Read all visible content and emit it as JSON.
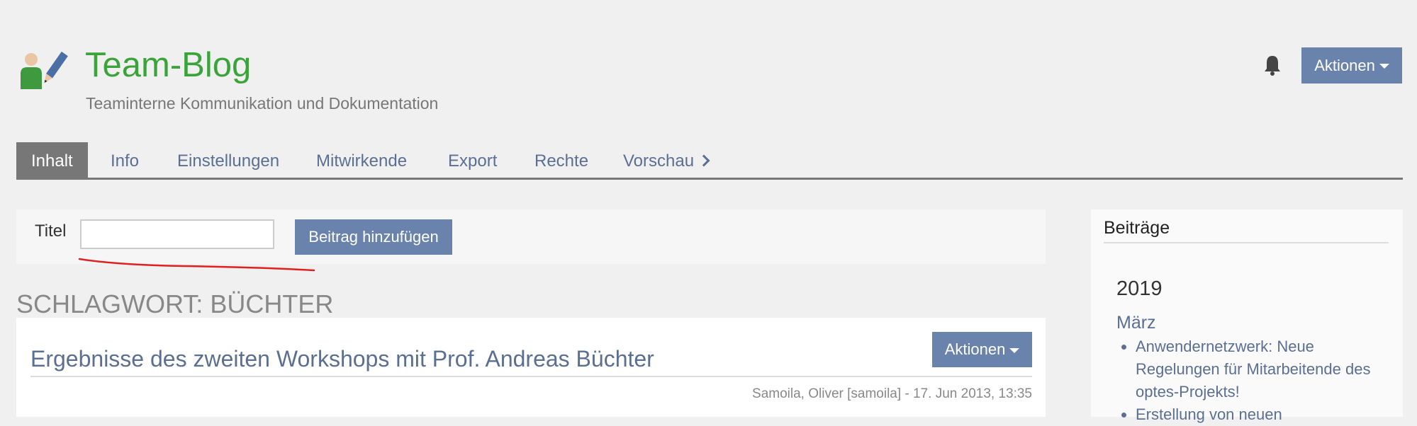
{
  "header": {
    "title": "Team-Blog",
    "subtitle": "Teaminterne Kommunikation und Dokumentation",
    "actions_label": "Aktionen",
    "icons": {
      "logo": "person-pencil-icon",
      "notifications": "bell-icon"
    }
  },
  "tabs": [
    {
      "label": "Inhalt",
      "active": true
    },
    {
      "label": "Info",
      "active": false
    },
    {
      "label": "Einstellungen",
      "active": false
    },
    {
      "label": "Mitwirkende",
      "active": false
    },
    {
      "label": "Export",
      "active": false
    },
    {
      "label": "Rechte",
      "active": false
    },
    {
      "label": "Vorschau",
      "active": false
    }
  ],
  "form": {
    "title_label": "Titel",
    "title_value": "",
    "add_button_label": "Beitrag hinzufügen"
  },
  "tag": {
    "heading": "Schlagwort: Büchter"
  },
  "post": {
    "title": "Ergebnisse des zweiten Workshops mit Prof. Andreas Büchter",
    "actions_label": "Aktionen",
    "meta": "Samoila, Oliver [samoila] - 17. Jun 2013, 13:35"
  },
  "sidebar": {
    "heading": "Beiträge",
    "year": "2019",
    "month": "März",
    "posts": [
      "Anwendernetzwerk: Neue Regelungen für Mitarbeitende des optes-Projekts!",
      "Erstellung von neuen"
    ]
  },
  "colors": {
    "brand_green": "#3aa43a",
    "button_blue": "#6a83ad",
    "link_blue": "#5b6f92",
    "annotation_red": "#e02020"
  }
}
